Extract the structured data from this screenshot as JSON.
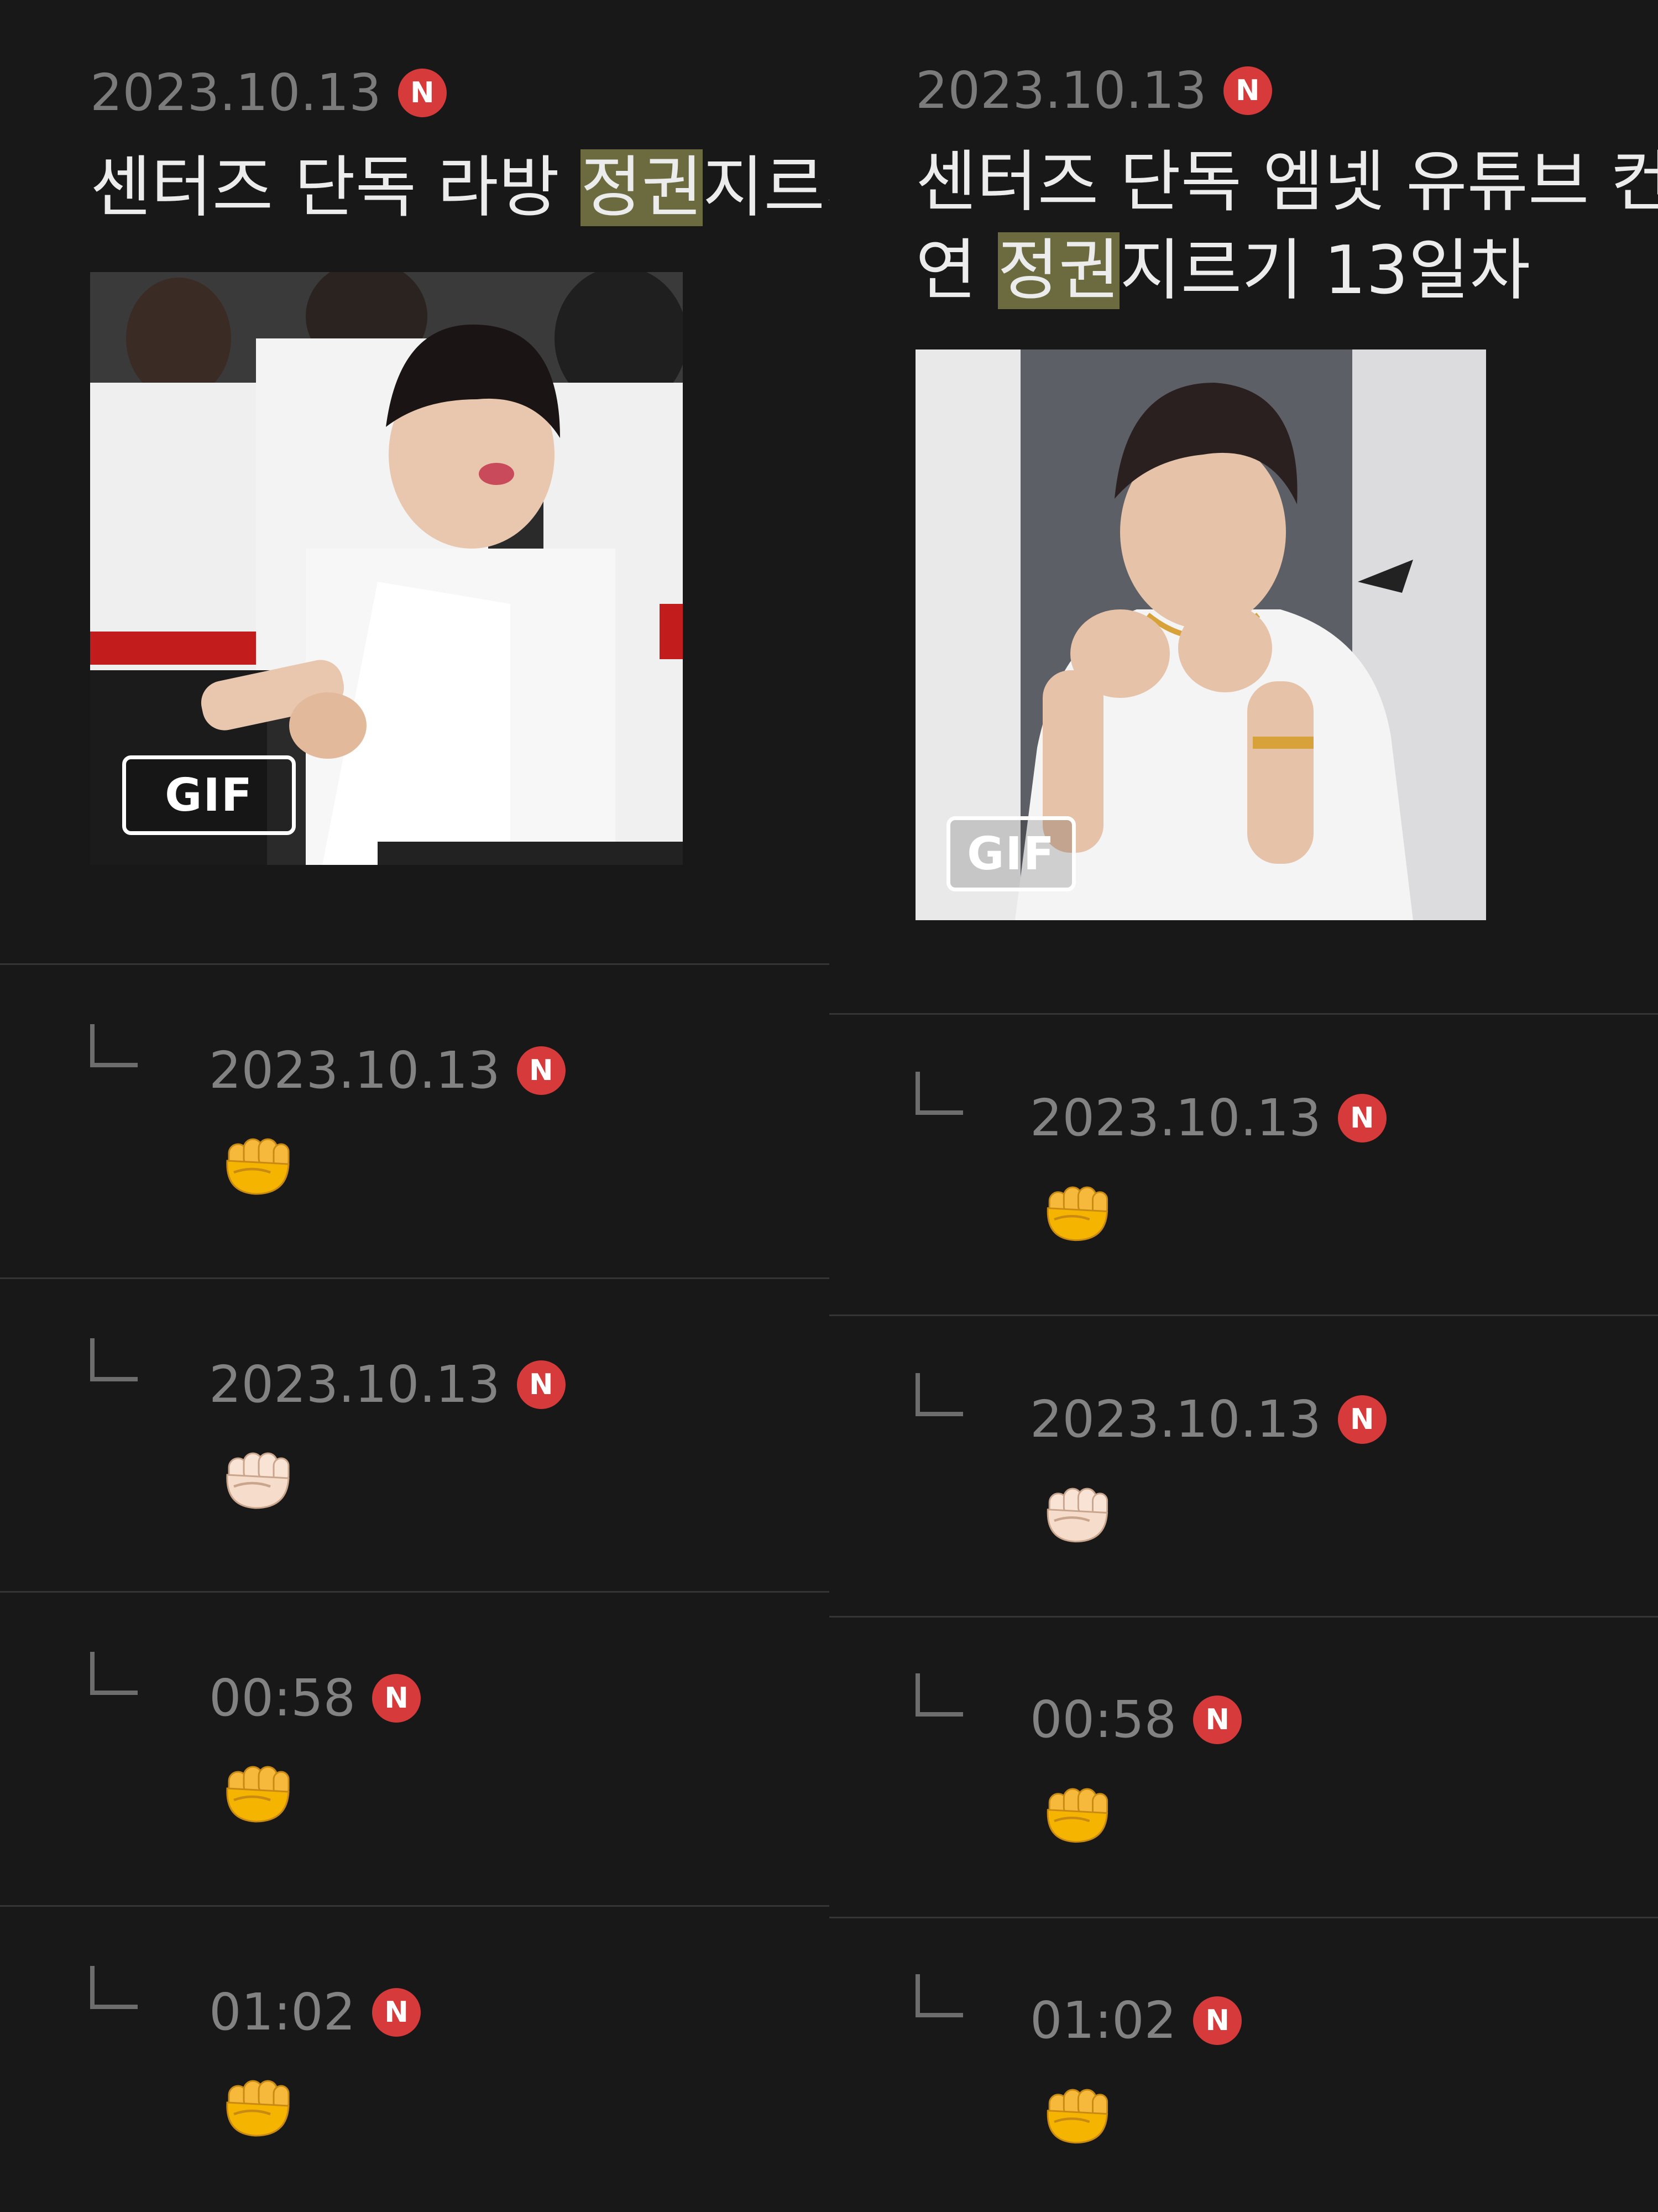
{
  "left": {
    "post": {
      "date": "2023.10.13",
      "badge": "N",
      "title_pre": "센터즈 단독 라방 ",
      "title_hl": "정권",
      "title_post": "지르기",
      "gif_label": "GIF"
    },
    "replies": [
      {
        "date": "2023.10.13",
        "badge": "N",
        "emoji": "fist-dark"
      },
      {
        "date": "2023.10.13",
        "badge": "N",
        "emoji": "fist-light"
      },
      {
        "date": "00:58",
        "badge": "N",
        "emoji": "fist-dark"
      },
      {
        "date": "01:02",
        "badge": "N",
        "emoji": "fist-dark"
      }
    ]
  },
  "right": {
    "post": {
      "date": "2023.10.13",
      "badge": "N",
      "title_line1": "센터즈 단독 엠넷 유튜브 컨텐",
      "title_line2_pre": "연 ",
      "title_line2_hl": "정권",
      "title_line2_post": "지르기 13일차",
      "gif_label": "GIF"
    },
    "replies": [
      {
        "date": "2023.10.13",
        "badge": "N",
        "emoji": "fist-dark"
      },
      {
        "date": "2023.10.13",
        "badge": "N",
        "emoji": "fist-light"
      },
      {
        "date": "00:58",
        "badge": "N",
        "emoji": "fist-dark"
      },
      {
        "date": "01:02",
        "badge": "N",
        "emoji": "fist-dark"
      }
    ]
  },
  "colors": {
    "background": "#181818",
    "badge_red": "#d63a3a",
    "highlight": "#6b6b3f",
    "fist_yellow": "#f4b400",
    "fist_light": "#f6dccb"
  }
}
